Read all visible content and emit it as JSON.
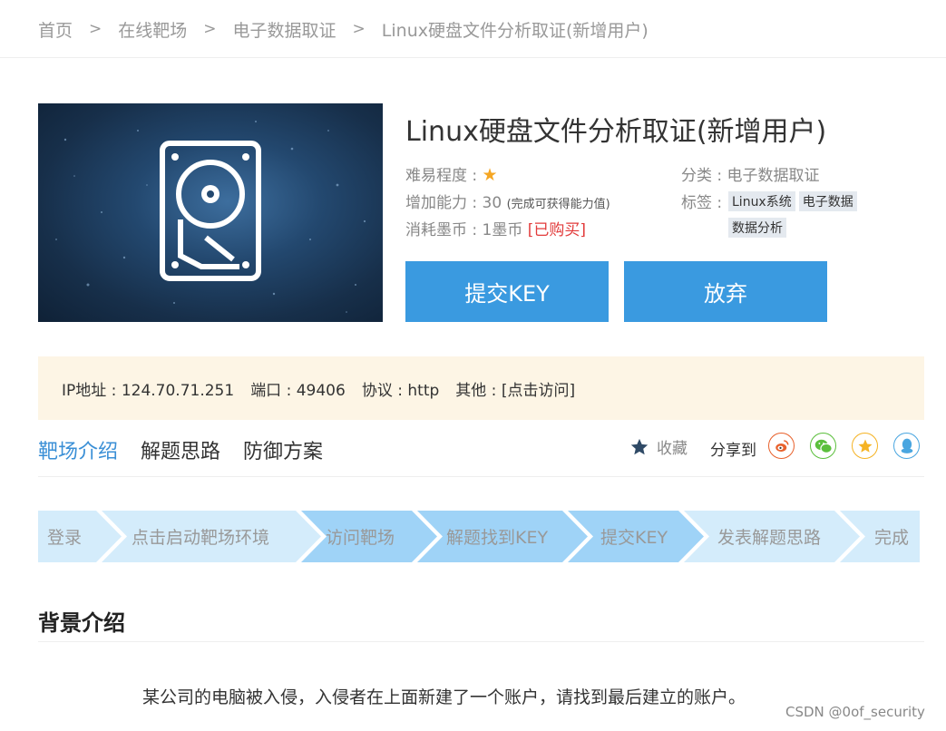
{
  "breadcrumb": {
    "items": [
      "首页",
      "在线靶场",
      "电子数据取证",
      "Linux硬盘文件分析取证(新增用户)"
    ],
    "separator": ">"
  },
  "cover": {
    "icon": "hard-drive-icon"
  },
  "challenge": {
    "title": "Linux硬盘文件分析取证(新增用户)",
    "difficulty_label": "难易程度 :",
    "difficulty_stars": 1,
    "ability_label": "增加能力 :",
    "ability_value": "30",
    "ability_note": "(完成可获得能力值)",
    "cost_label": "消耗墨币 :",
    "cost_value": "1墨币",
    "purchased": "[已购买]",
    "category_label": "分类 :",
    "category_value": "电子数据取证",
    "tags_label": "标签 :",
    "tags": [
      "Linux系统",
      "电子数据",
      "数据分析"
    ]
  },
  "actions": {
    "submit_key": "提交KEY",
    "give_up": "放弃"
  },
  "access": {
    "ip_label": "IP地址 :",
    "ip_value": "124.70.71.251",
    "port_label": "端口 :",
    "port_value": "49406",
    "protocol_label": "协议 :",
    "protocol_value": "http",
    "other_label": "其他 :",
    "other_link": "[点击访问]"
  },
  "tabs": [
    "靶场介绍",
    "解题思路",
    "防御方案"
  ],
  "active_tab": "靶场介绍",
  "social": {
    "favorite": "收藏",
    "share_label": "分享到",
    "share_icons": [
      "weibo-icon",
      "wechat-icon",
      "qzone-icon",
      "qq-icon"
    ]
  },
  "steps": [
    "登录",
    "点击启动靶场环境",
    "访问靶场",
    "解题找到KEY",
    "提交KEY",
    "发表解题思路",
    "完成"
  ],
  "background": {
    "title": "背景介绍",
    "text": "某公司的电脑被入侵，入侵者在上面新建了一个账户，请找到最后建立的账户。"
  },
  "watermark": "CSDN @0of_security",
  "colors": {
    "accent": "#3a9ae0",
    "tab_active": "#3a8fd6",
    "info_bg": "#fdf5e5",
    "step_light": "#d4ecfb",
    "step_dark": "#9fd3f7",
    "star": "#f5a623",
    "purchased": "#e23b3b"
  }
}
